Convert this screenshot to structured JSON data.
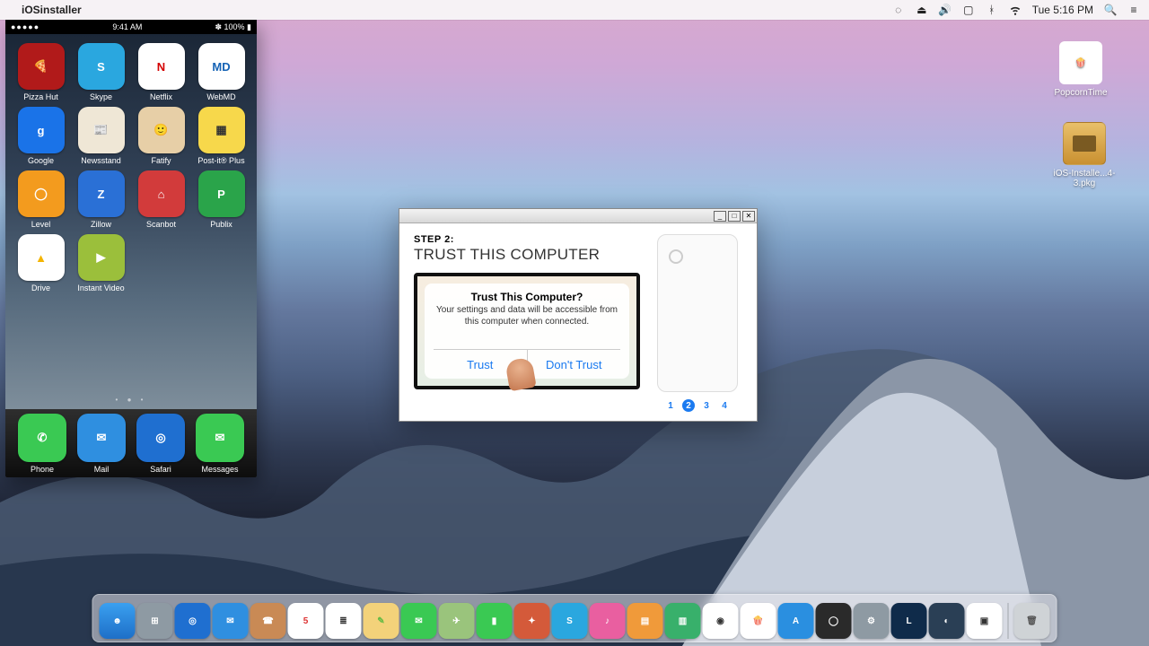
{
  "menubar": {
    "apple_glyph": "",
    "app_name": "iOSinstaller",
    "clock": "Tue 5:16 PM",
    "battery_pct": "",
    "icons": [
      "opt-icon",
      "eject-icon",
      "volume-icon",
      "airplay-icon",
      "bluetooth-icon",
      "wifi-icon",
      "spotlight-icon",
      "menu-icon"
    ]
  },
  "desktop_icons": {
    "popcorn": "PopcornTime",
    "pkg": "iOS-Installe...4-3.pkg"
  },
  "phone": {
    "carrier_dots": "●●●●●",
    "time": "9:41 AM",
    "right_status": "✽ 100% ▮",
    "apps": [
      {
        "label": "Pizza Hut",
        "bg": "#b11a1a",
        "glyph": "🍕"
      },
      {
        "label": "Skype",
        "bg": "#2aa7df",
        "glyph": "S"
      },
      {
        "label": "Netflix",
        "bg": "#ffffff",
        "glyph": "N",
        "fg": "#d40000"
      },
      {
        "label": "WebMD",
        "bg": "#ffffff",
        "glyph": "MD",
        "fg": "#1663b5"
      },
      {
        "label": "Google",
        "bg": "#1a73e8",
        "glyph": "g"
      },
      {
        "label": "Newsstand",
        "bg": "#efe7d6",
        "glyph": "📰",
        "fg": "#333"
      },
      {
        "label": "Fatify",
        "bg": "#e7cfa7",
        "glyph": "🙂",
        "fg": "#333"
      },
      {
        "label": "Post-it® Plus",
        "bg": "#f7d84b",
        "glyph": "▦",
        "fg": "#333"
      },
      {
        "label": "Level",
        "bg": "#f39b1e",
        "glyph": "◯"
      },
      {
        "label": "Zillow",
        "bg": "#2a70d6",
        "glyph": "Z"
      },
      {
        "label": "Scanbot",
        "bg": "#d23b3b",
        "glyph": "⌂"
      },
      {
        "label": "Publix",
        "bg": "#2aa44a",
        "glyph": "P"
      },
      {
        "label": "Drive",
        "bg": "#ffffff",
        "glyph": "▲",
        "fg": "#f4b400"
      },
      {
        "label": "Instant Video",
        "bg": "#9bbf3b",
        "glyph": "▶"
      }
    ],
    "dock": [
      {
        "label": "Phone",
        "bg": "#3ac953",
        "glyph": "✆"
      },
      {
        "label": "Mail",
        "bg": "#2f8fe0",
        "glyph": "✉"
      },
      {
        "label": "Safari",
        "bg": "#1f6fd0",
        "glyph": "◎"
      },
      {
        "label": "Messages",
        "bg": "#3ac953",
        "glyph": "✉"
      }
    ]
  },
  "installer": {
    "step_label": "STEP 2:",
    "heading": "TRUST THIS COMPUTER",
    "prompt_title": "Trust This Computer?",
    "prompt_desc": "Your settings and data will be accessible from this computer when connected.",
    "trust": "Trust",
    "dont_trust": "Don't Trust",
    "pager": [
      "1",
      "2",
      "3",
      "4"
    ],
    "active_page": 2
  },
  "dock": [
    {
      "name": "finder",
      "bg": "linear-gradient(#3aa0f0,#1e6fc8)",
      "glyph": "☻"
    },
    {
      "name": "launchpad",
      "bg": "#8e9aa3",
      "glyph": "⊞"
    },
    {
      "name": "safari",
      "bg": "#1f6fd0",
      "glyph": "◎"
    },
    {
      "name": "mail",
      "bg": "#2f8fe0",
      "glyph": "✉"
    },
    {
      "name": "contacts",
      "bg": "#c98a55",
      "glyph": "☎"
    },
    {
      "name": "calendar",
      "bg": "#ffffff",
      "glyph": "5",
      "fg": "#d33"
    },
    {
      "name": "reminders",
      "bg": "#ffffff",
      "glyph": "≣",
      "fg": "#333"
    },
    {
      "name": "notes",
      "bg": "#f3d27a",
      "glyph": "✎",
      "fg": "#6b4"
    },
    {
      "name": "messages",
      "bg": "#3ac953",
      "glyph": "✉"
    },
    {
      "name": "maps",
      "bg": "#9ac47c",
      "glyph": "✈"
    },
    {
      "name": "facetime",
      "bg": "#3ac953",
      "glyph": "▮"
    },
    {
      "name": "photobooth",
      "bg": "#d45a3a",
      "glyph": "✦"
    },
    {
      "name": "skype",
      "bg": "#2aa7df",
      "glyph": "S"
    },
    {
      "name": "itunes",
      "bg": "#e95fa0",
      "glyph": "♪"
    },
    {
      "name": "ibooks",
      "bg": "#f09a3a",
      "glyph": "▤"
    },
    {
      "name": "numbers",
      "bg": "#38b06b",
      "glyph": "▥"
    },
    {
      "name": "chrome",
      "bg": "#ffffff",
      "glyph": "◉",
      "fg": "#333"
    },
    {
      "name": "popcorn",
      "bg": "#ffffff",
      "glyph": "🍿",
      "fg": "#b33"
    },
    {
      "name": "appstore",
      "bg": "#2a8fe0",
      "glyph": "A"
    },
    {
      "name": "obs",
      "bg": "#2a2a2a",
      "glyph": "◯"
    },
    {
      "name": "sysprefs",
      "bg": "#8e9aa3",
      "glyph": "⚙"
    },
    {
      "name": "game-l",
      "bg": "#0f2b4a",
      "glyph": "L"
    },
    {
      "name": "steam",
      "bg": "#2a3f55",
      "glyph": "◐"
    },
    {
      "name": "iosinstaller",
      "bg": "#ffffff",
      "glyph": "▣",
      "fg": "#333"
    },
    {
      "name": "trash",
      "bg": "#cfd3d6",
      "glyph": "🗑",
      "fg": "#555"
    }
  ]
}
